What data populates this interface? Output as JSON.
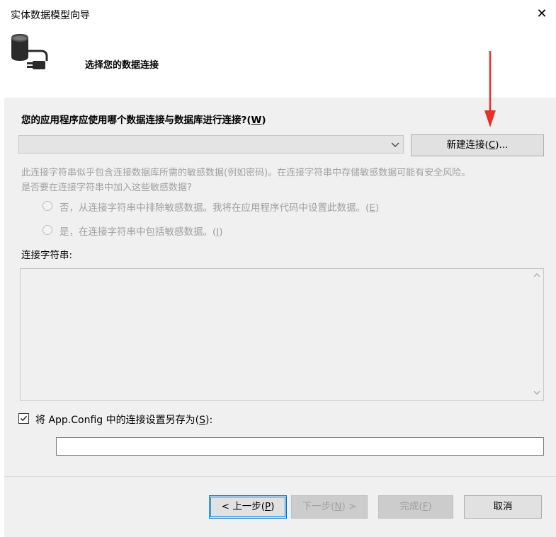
{
  "window": {
    "title": "实体数据模型向导",
    "close_glyph": "✕"
  },
  "header": {
    "title": "选择您的数据连接",
    "icon": "database-plug-icon"
  },
  "question": {
    "text": "您的应用程序应使用哪个数据连接与数据库进行连接?",
    "mnemonic": "W",
    "prefix": "(",
    "suffix": ")"
  },
  "connection_select": {
    "value": ""
  },
  "new_connection_button": {
    "label": "新建连接(",
    "mnemonic": "C",
    "suffix": ")..."
  },
  "sensitive": {
    "warning_line1": "此连接字符串似乎包含连接数据库所需的敏感数据(例如密码)。在连接字符串中存储敏感数据可能有安全风险。",
    "warning_line2": "是否要在连接字符串中加入这些敏感数据?",
    "option_exclude": {
      "label": "否，从连接字符串中排除敏感数据。我将在应用程序代码中设置此数据。(",
      "mnemonic": "E",
      "suffix": ")"
    },
    "option_include": {
      "label": "是，在连接字符串中包括敏感数据。(",
      "mnemonic": "I",
      "suffix": ")"
    }
  },
  "connection_string": {
    "label": "连接字符串:",
    "value": ""
  },
  "save_config": {
    "checked": true,
    "check_glyph": "✓",
    "label": "将 App.Config 中的连接设置另存为(",
    "mnemonic": "S",
    "suffix": "):",
    "value": ""
  },
  "footer": {
    "prev": {
      "label": "< 上一步(",
      "mnemonic": "P",
      "suffix": ")"
    },
    "next": {
      "label": "下一步(",
      "mnemonic": "N",
      "suffix": ") >"
    },
    "finish": {
      "label": "完成(",
      "mnemonic": "F",
      "suffix": ")"
    },
    "cancel": {
      "label": "取消"
    }
  },
  "colors": {
    "arrow_annotation": "#e8302a",
    "focus_border": "#0078d7",
    "disabled_text": "#a0a0a0"
  }
}
